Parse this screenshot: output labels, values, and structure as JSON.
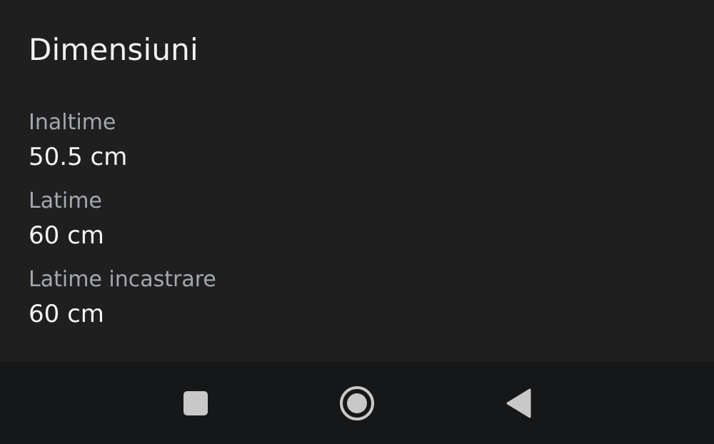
{
  "section": {
    "title": "Dimensiuni"
  },
  "specs": [
    {
      "label": "Inaltime",
      "value": "50.5 cm"
    },
    {
      "label": "Latime",
      "value": "60 cm"
    },
    {
      "label": "Latime incastrare",
      "value": "60 cm"
    }
  ],
  "nav": {
    "recents_icon": "square-icon",
    "home_icon": "circle-home-icon",
    "back_icon": "triangle-back-icon"
  },
  "colors": {
    "background": "#1f1f20",
    "nav_background": "#161719",
    "label": "#a3a8b0",
    "value": "#f4f4f4",
    "nav_icon": "#c8c8c8"
  }
}
